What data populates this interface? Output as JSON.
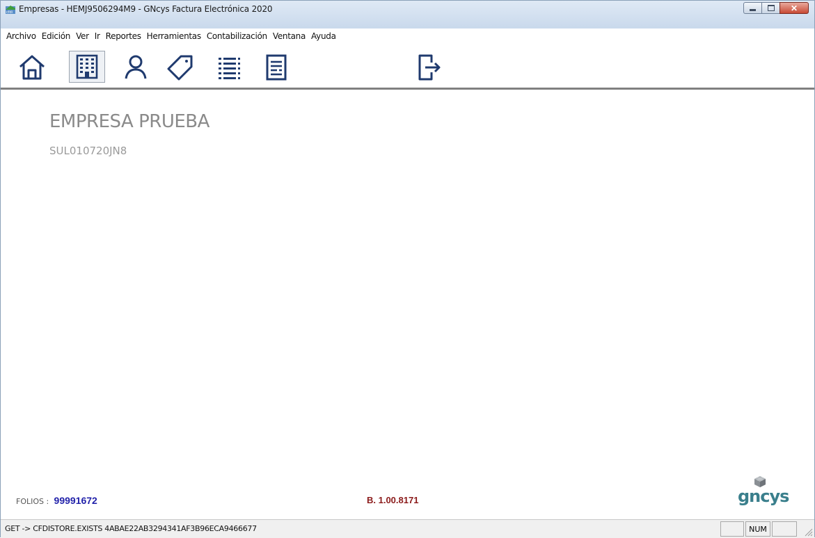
{
  "window": {
    "title": "Empresas - HEMJ9506294M9 - GNcys Factura Electrónica 2020",
    "controls": {
      "close_label": "✕"
    }
  },
  "menu": [
    {
      "label": "Archivo"
    },
    {
      "label": "Edición"
    },
    {
      "label": "Ver"
    },
    {
      "label": "Ir"
    },
    {
      "label": "Reportes"
    },
    {
      "label": "Herramientas"
    },
    {
      "label": "Contabilización"
    },
    {
      "label": "Ventana"
    },
    {
      "label": "Ayuda"
    }
  ],
  "toolbar": {
    "icons": [
      "home-icon",
      "building-icon",
      "user-icon",
      "tag-icon",
      "list-icon",
      "document-icon",
      "exit-icon"
    ],
    "selected": "building-icon",
    "icon_color": "#1f3a6e"
  },
  "company": {
    "name": "EMPRESA PRUEBA",
    "rfc": "SUL010720JN8"
  },
  "footer": {
    "folios_label": "FOLIOS :",
    "folios_value": "99991672",
    "build": "B. 1.00.8171",
    "brand": "gncys"
  },
  "status": {
    "message": "GET -> CFDISTORE.EXISTS 4ABAE22AB3294341AF3B96ECA9466677",
    "num_indicator": "NUM"
  }
}
